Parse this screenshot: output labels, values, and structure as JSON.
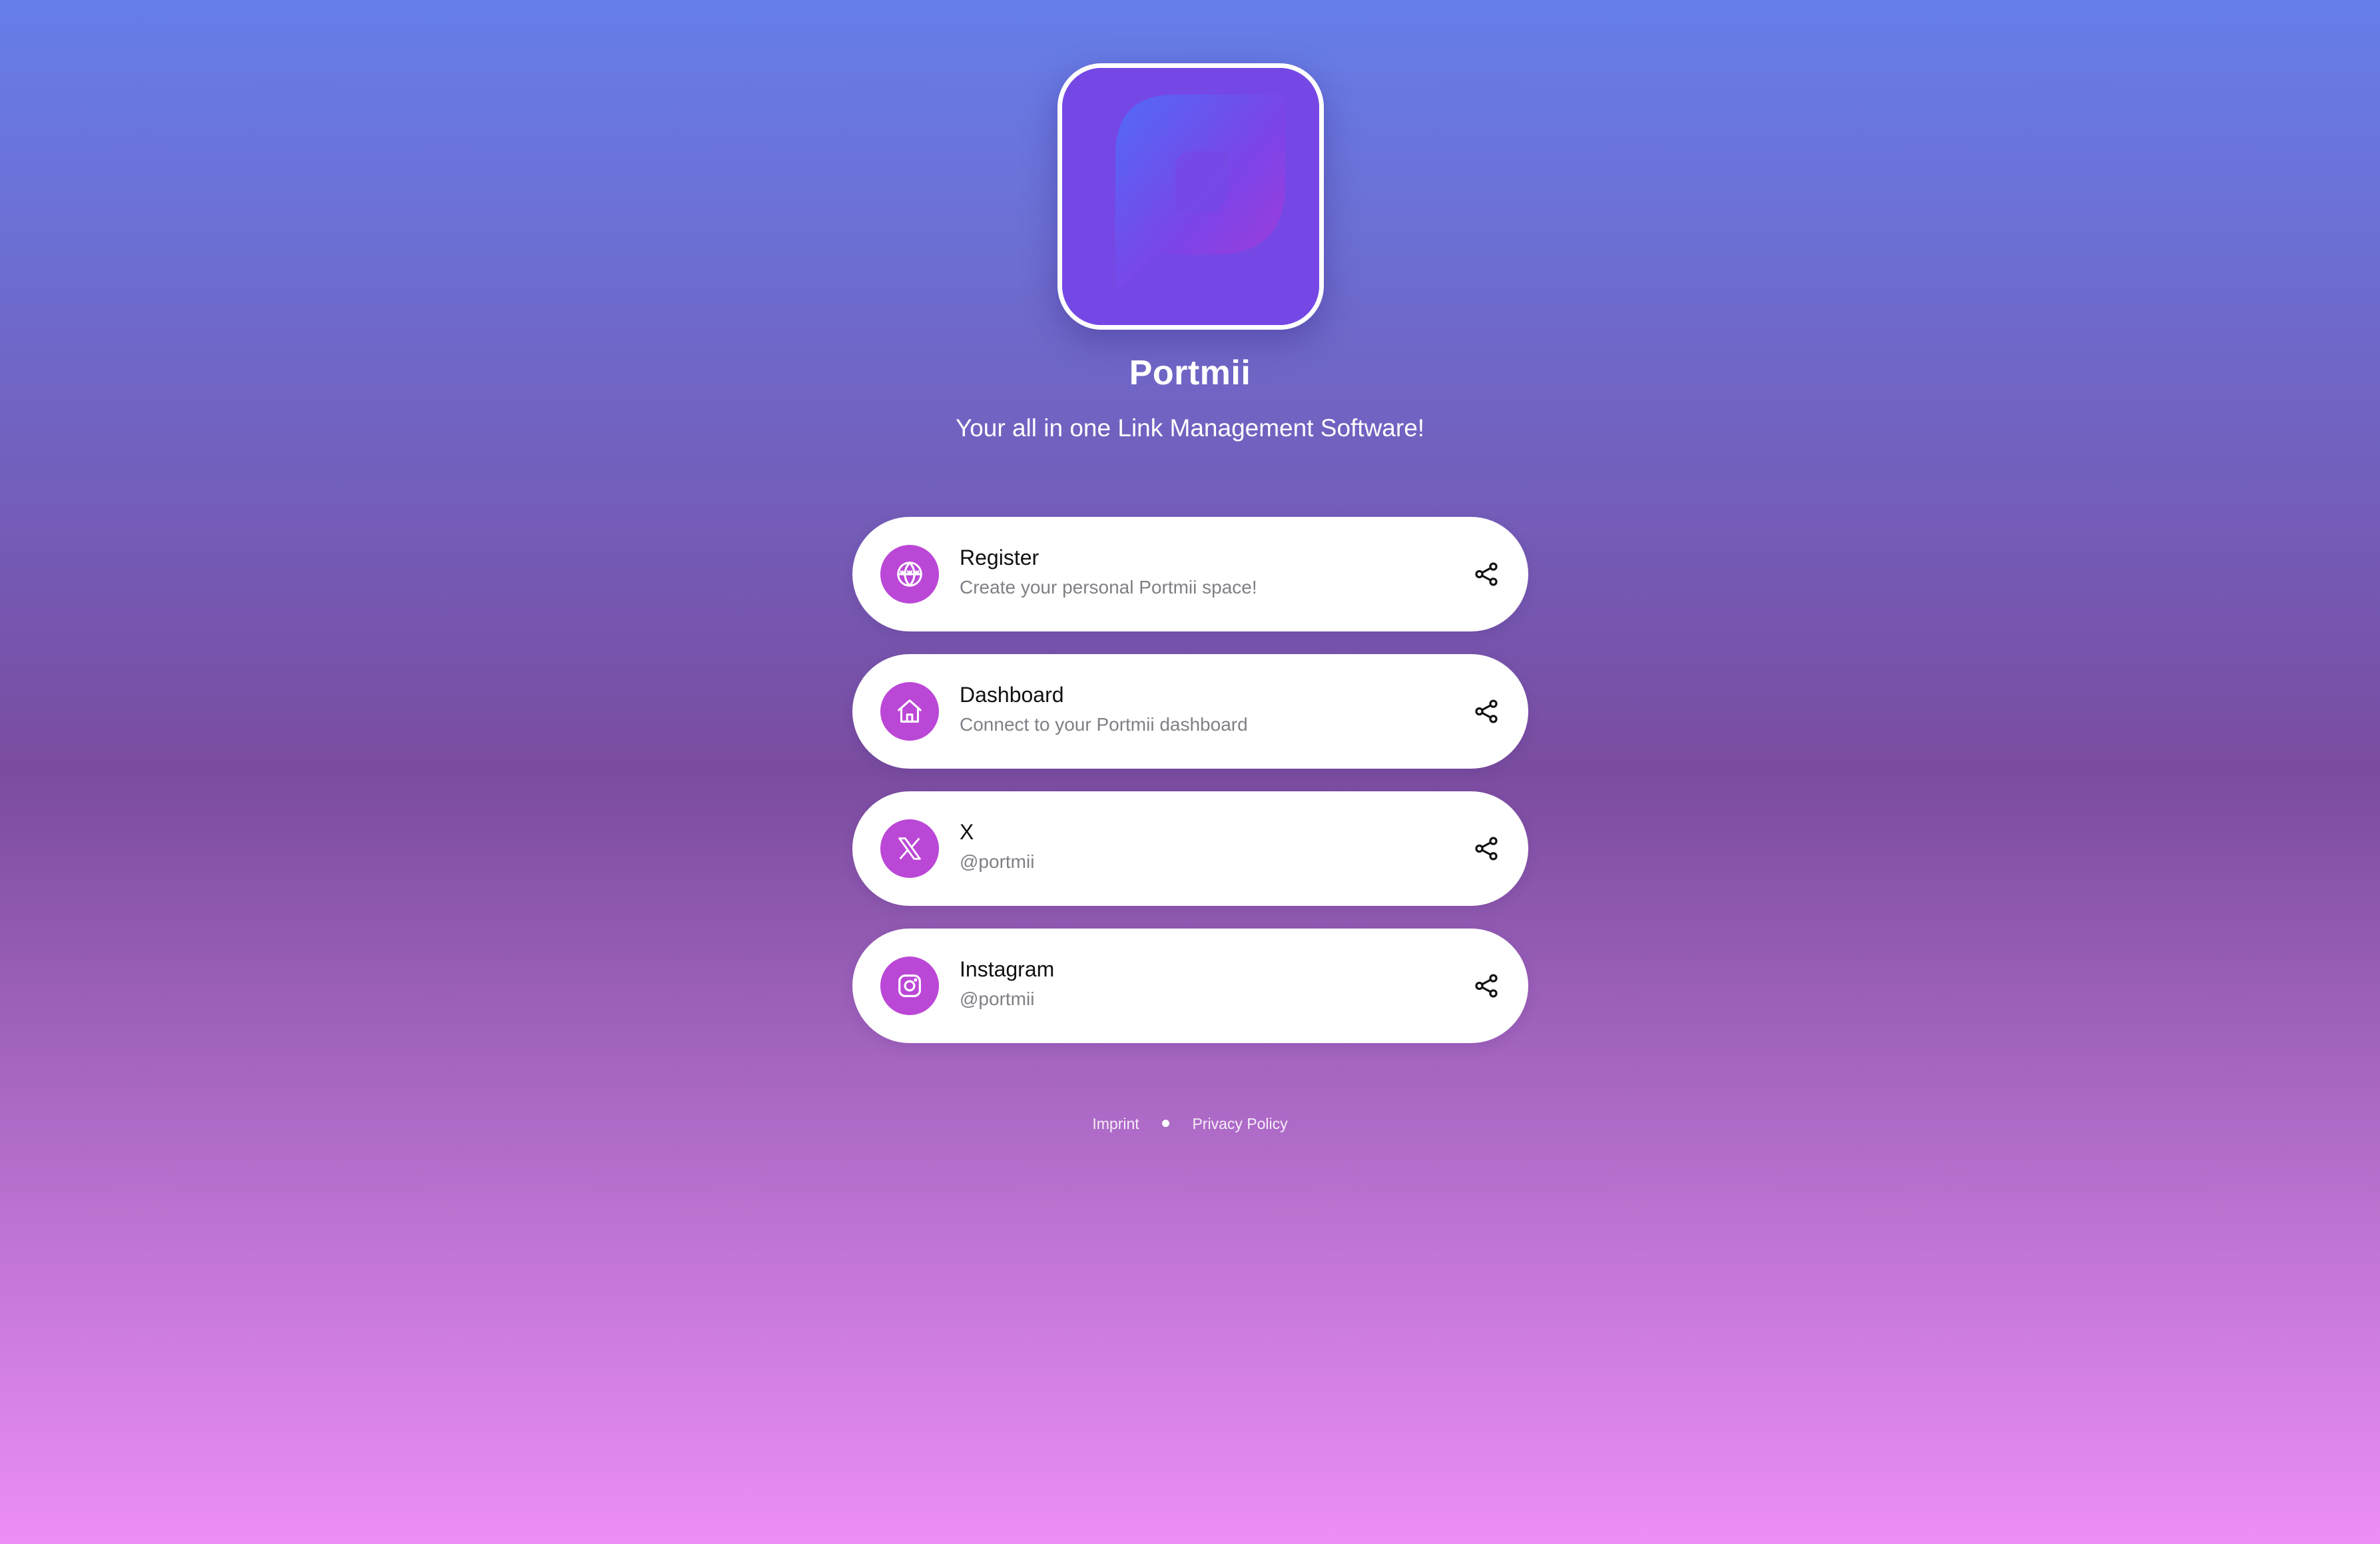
{
  "profile": {
    "name": "Portmii",
    "bio": "Your all in one Link Management Software!",
    "logo_icon": "portmii-logo"
  },
  "links": [
    {
      "title": "Register",
      "subtitle": "Create your personal Portmii space!",
      "icon": "www-globe-icon",
      "action_icon": "share-icon"
    },
    {
      "title": "Dashboard",
      "subtitle": "Connect to your Portmii dashboard",
      "icon": "home-icon",
      "action_icon": "share-icon"
    },
    {
      "title": "X",
      "subtitle": "@portmii",
      "icon": "x-icon",
      "action_icon": "share-icon"
    },
    {
      "title": "Instagram",
      "subtitle": "@portmii",
      "icon": "instagram-icon",
      "action_icon": "share-icon"
    }
  ],
  "footer": {
    "imprint": "Imprint",
    "privacy": "Privacy Policy"
  },
  "colors": {
    "gradient_top": "#667eea",
    "gradient_mid": "#7a4ca0",
    "gradient_bottom": "#ec8ef6",
    "icon_circle": "#bb47d7",
    "logo_bg": "#7548e6"
  }
}
